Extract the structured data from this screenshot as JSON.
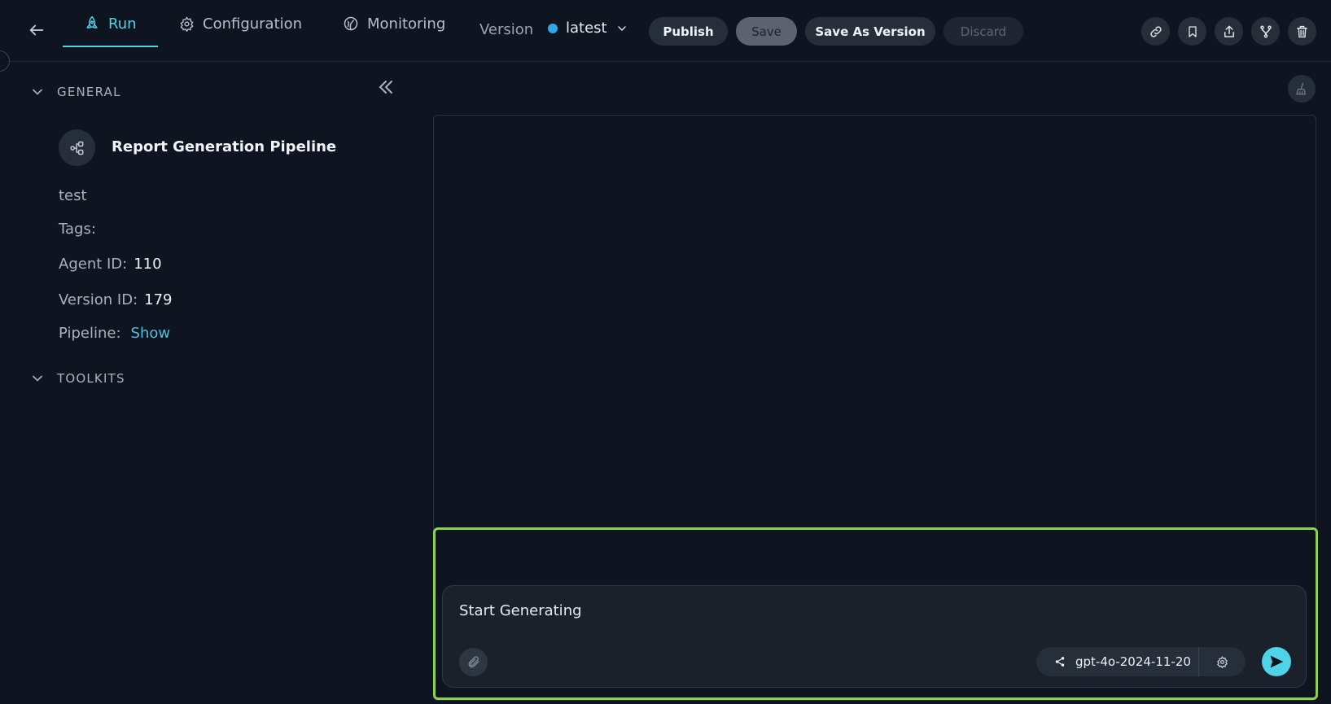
{
  "header": {
    "tabs": [
      {
        "label": "Run",
        "icon": "rocket-icon",
        "active": true
      },
      {
        "label": "Configuration",
        "icon": "gear-icon",
        "active": false
      },
      {
        "label": "Monitoring",
        "icon": "monitoring-icon",
        "active": false
      }
    ],
    "version_label": "Version",
    "version_value": "latest",
    "version_status_color": "#2fa8ea",
    "buttons": {
      "publish": "Publish",
      "save": "Save",
      "save_as_version": "Save As Version",
      "discard": "Discard"
    },
    "action_icons": [
      "link-icon",
      "bookmark-icon",
      "share-icon",
      "fork-icon",
      "trash-icon"
    ]
  },
  "sidebar": {
    "general_label": "GENERAL",
    "toolkits_label": "TOOLKITS",
    "agent_name": "Report Generation Pipeline",
    "description": "test",
    "tags_label": "Tags:",
    "agent_id_label": "Agent ID:",
    "agent_id": "110",
    "version_id_label": "Version ID:",
    "version_id": "179",
    "pipeline_label": "Pipeline:",
    "pipeline_link": "Show"
  },
  "chat": {
    "input_value": "Start Generating",
    "model": "gpt-4o-2024-11-20",
    "accent_color": "#4fd3e8",
    "highlight_color": "#8fd14f"
  }
}
